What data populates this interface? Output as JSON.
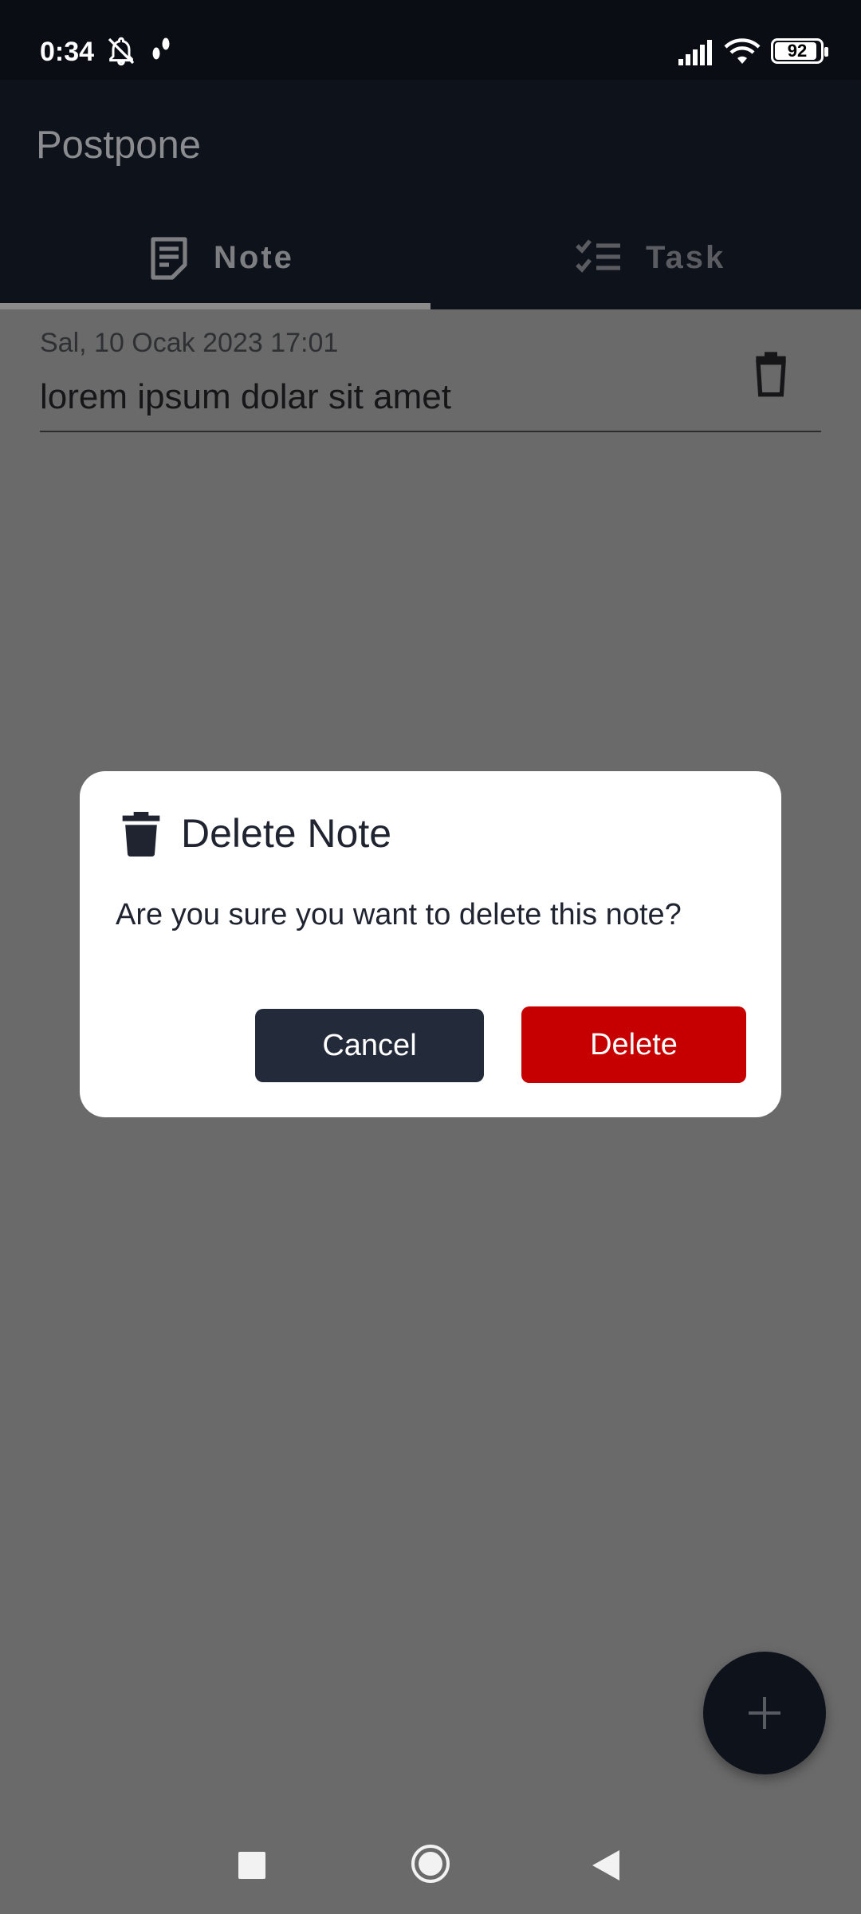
{
  "status_bar": {
    "time": "0:34",
    "battery": "92",
    "icons": [
      "bell-off-icon",
      "walk-icon",
      "signal-icon",
      "wifi-icon",
      "battery-icon"
    ]
  },
  "app": {
    "title": "Postpone"
  },
  "tabs": [
    {
      "label": "Note",
      "icon": "note-icon",
      "selected": true
    },
    {
      "label": "Task",
      "icon": "checklist-icon",
      "selected": false
    }
  ],
  "notes": [
    {
      "date": "Sal, 10 Ocak 2023 17:01",
      "text": "lorem ipsum dolar sit amet"
    }
  ],
  "dialog": {
    "title": "Delete Note",
    "icon": "trash-icon",
    "message": "Are you sure you want to delete this note?",
    "cancel_label": "Cancel",
    "delete_label": "Delete"
  },
  "fab": {
    "icon": "plus-icon"
  },
  "nav_bar": {
    "buttons": [
      "recents-button",
      "home-button",
      "back-button"
    ]
  },
  "colors": {
    "scrim": "#6a6a6a",
    "app_bar": "#0e121a",
    "dialog_bg": "#ffffff",
    "cancel_button": "#232a3a",
    "delete_button": "#c60000",
    "text_dark": "#1f2430"
  }
}
